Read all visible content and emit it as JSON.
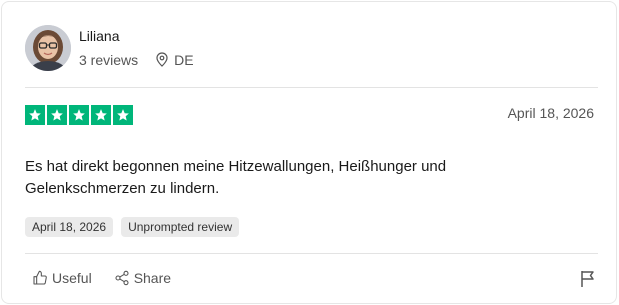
{
  "reviewer": {
    "name": "Liliana",
    "reviews": "3 reviews",
    "country": "DE"
  },
  "rating": {
    "stars": 5,
    "max": 5,
    "color": "#00b67a"
  },
  "review": {
    "date": "April 18, 2026",
    "text_line1": "Es hat direkt begonnen meine Hitzewallungen, Heißhunger und",
    "text_line2": "Gelenkschmerzen zu lindern."
  },
  "tags": {
    "date_tag": "April 18, 2026",
    "type_tag": "Unprompted review"
  },
  "actions": {
    "useful": "Useful",
    "share": "Share"
  },
  "icons": [
    "location-pin-icon",
    "star-icon",
    "thumbs-up-icon",
    "share-icon",
    "flag-icon"
  ]
}
